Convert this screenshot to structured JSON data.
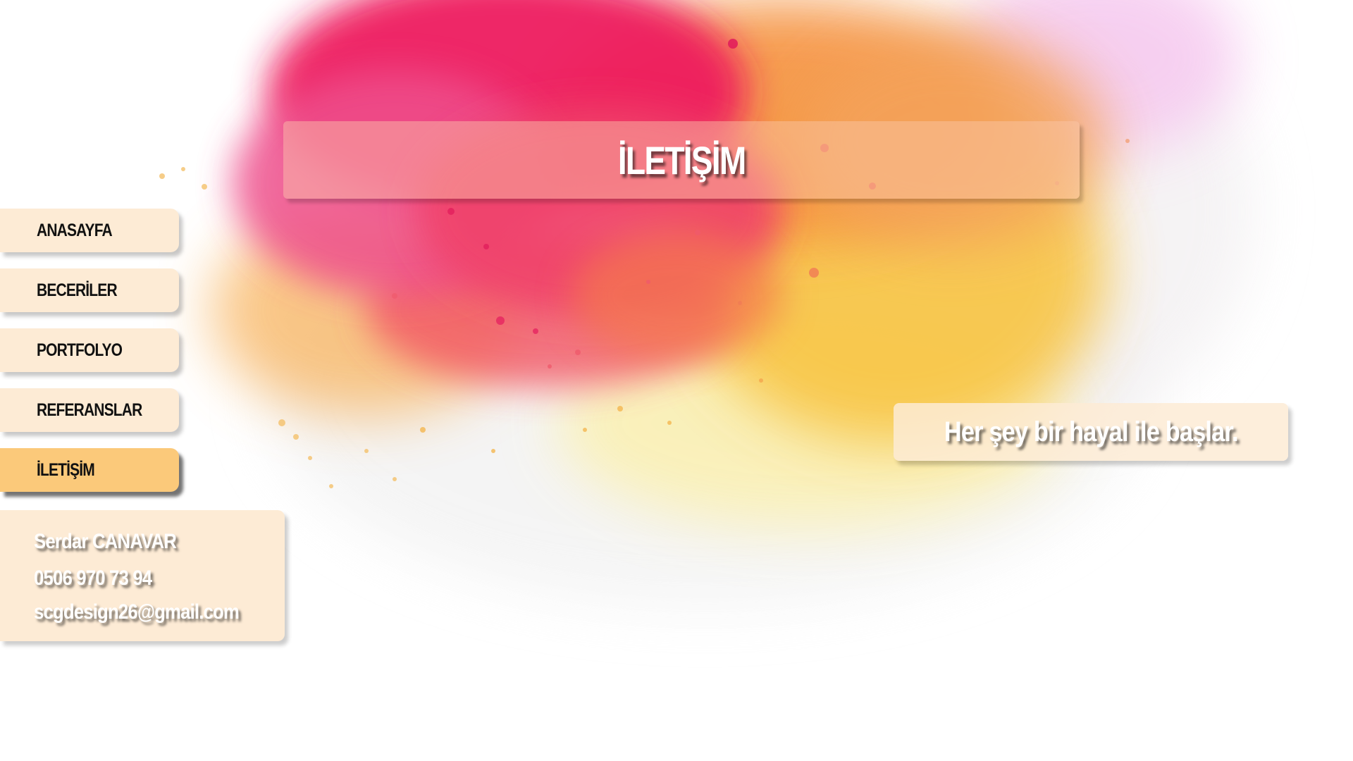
{
  "page": {
    "title": "İLETİŞİM",
    "slogan": "Her şey bir hayal ile başlar."
  },
  "nav": {
    "items": [
      {
        "label": "ANASAYFA",
        "active": false
      },
      {
        "label": "BECERİLER",
        "active": false
      },
      {
        "label": "PORTFOLYO",
        "active": false
      },
      {
        "label": "REFERANSLAR",
        "active": false
      },
      {
        "label": "İLETİŞİM",
        "active": true
      }
    ]
  },
  "contact": {
    "name": "Serdar CANAVAR",
    "phone": "0506 970 73 94",
    "email": "scgdesign26@gmail.com"
  },
  "colors": {
    "nav_bg": "#fdebd5",
    "nav_active_bg": "#fbc97a",
    "splash_magenta": "#ee1c5f",
    "splash_orange": "#f5913e",
    "splash_yellow": "#f8c443"
  }
}
